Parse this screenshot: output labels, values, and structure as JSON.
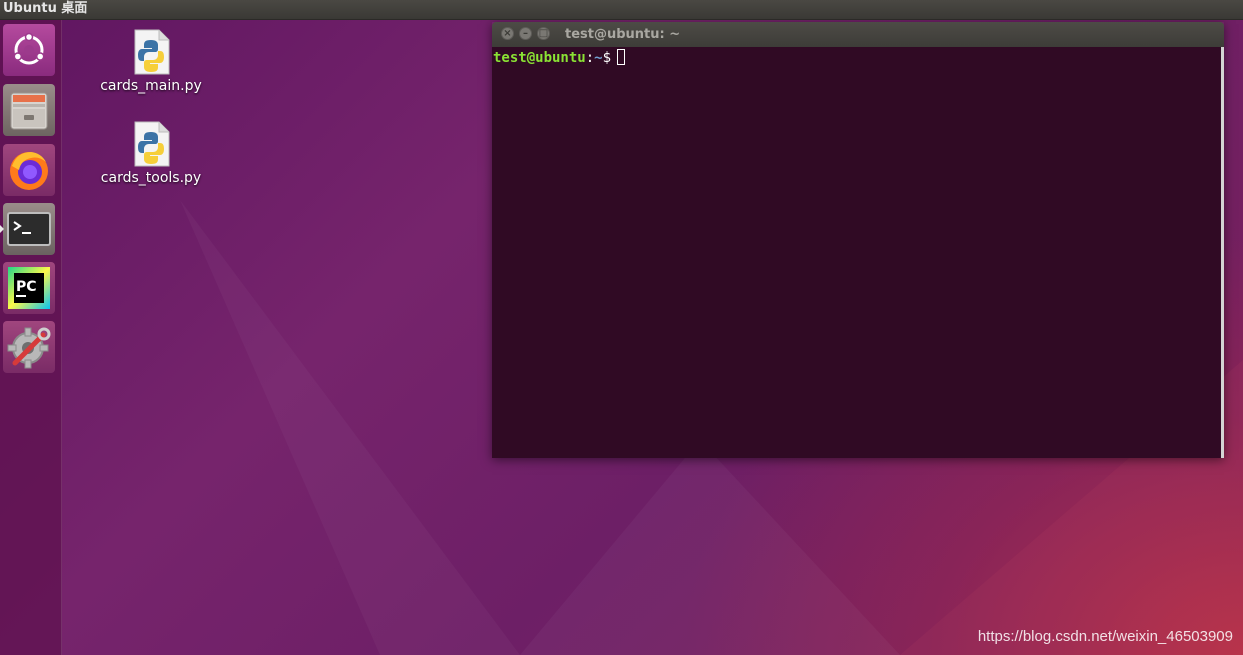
{
  "top_panel": {
    "title": "Ubuntu 桌面"
  },
  "launcher": {
    "items": [
      {
        "name": "ubuntu-dash-icon"
      },
      {
        "name": "files-icon"
      },
      {
        "name": "firefox-icon"
      },
      {
        "name": "terminal-icon"
      },
      {
        "name": "pycharm-icon",
        "glyph": "PC"
      },
      {
        "name": "settings-icon"
      }
    ]
  },
  "desktop_icons": [
    {
      "label": "cards_main.py",
      "icon": "python-file-icon"
    },
    {
      "label": "cards_tools.py",
      "icon": "python-file-icon"
    }
  ],
  "terminal": {
    "title": "test@ubuntu: ~",
    "prompt_user": "test@ubuntu",
    "prompt_sep": ":",
    "prompt_path": "~",
    "prompt_dollar": "$",
    "buttons": {
      "close": "×",
      "minimize": "–",
      "maximize": "□"
    }
  },
  "watermark": "https://blog.csdn.net/weixin_46503909",
  "colors": {
    "terminal_bg": "#300a24",
    "prompt_user": "#8ae234",
    "prompt_path": "#729fcf",
    "panel": "#3c3b37"
  }
}
